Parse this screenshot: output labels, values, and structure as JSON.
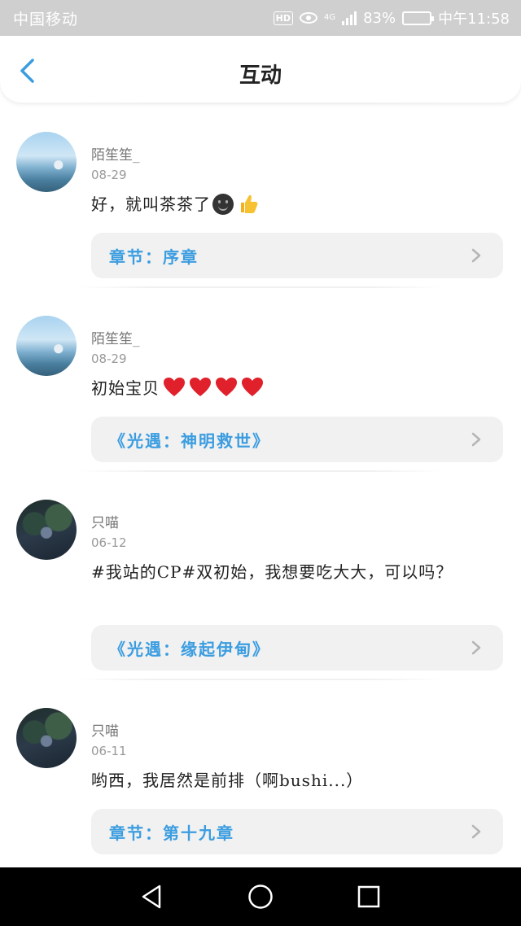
{
  "status_bar": {
    "carrier": "中国移动",
    "network": "4G",
    "hd": "HD",
    "battery": "83%",
    "battery_level": 0.83,
    "time": "中午11:58"
  },
  "header": {
    "title": "互动",
    "back_icon": "chevron-left-icon"
  },
  "colors": {
    "accent": "#3b9de0",
    "card_bg": "#f1f1f1",
    "status_bg": "#cfcfcf"
  },
  "items": [
    {
      "username": "陌笙笙_",
      "date": "08-29",
      "text": "好，就叫茶茶了",
      "emoji": [
        "neutral-face-icon",
        "thumbs-up-icon"
      ],
      "link": "章节：序章"
    },
    {
      "username": "陌笙笙_",
      "date": "08-29",
      "text": "初始宝贝",
      "emoji": [
        "heart-icon",
        "heart-icon",
        "heart-icon",
        "heart-icon"
      ],
      "link": "《光遇：神明救世》"
    },
    {
      "username": "只喵",
      "date": "06-12",
      "text": "#我站的CP#双初始，我想要吃大大，可以吗？",
      "link": "《光遇：缘起伊甸》"
    },
    {
      "username": "只喵",
      "date": "06-11",
      "text": "哟西，我居然是前排（啊bushi...）",
      "link": "章节：第十九章"
    }
  ],
  "nav": {
    "back": "triangle-back-icon",
    "home": "circle-home-icon",
    "recents": "square-recents-icon"
  }
}
